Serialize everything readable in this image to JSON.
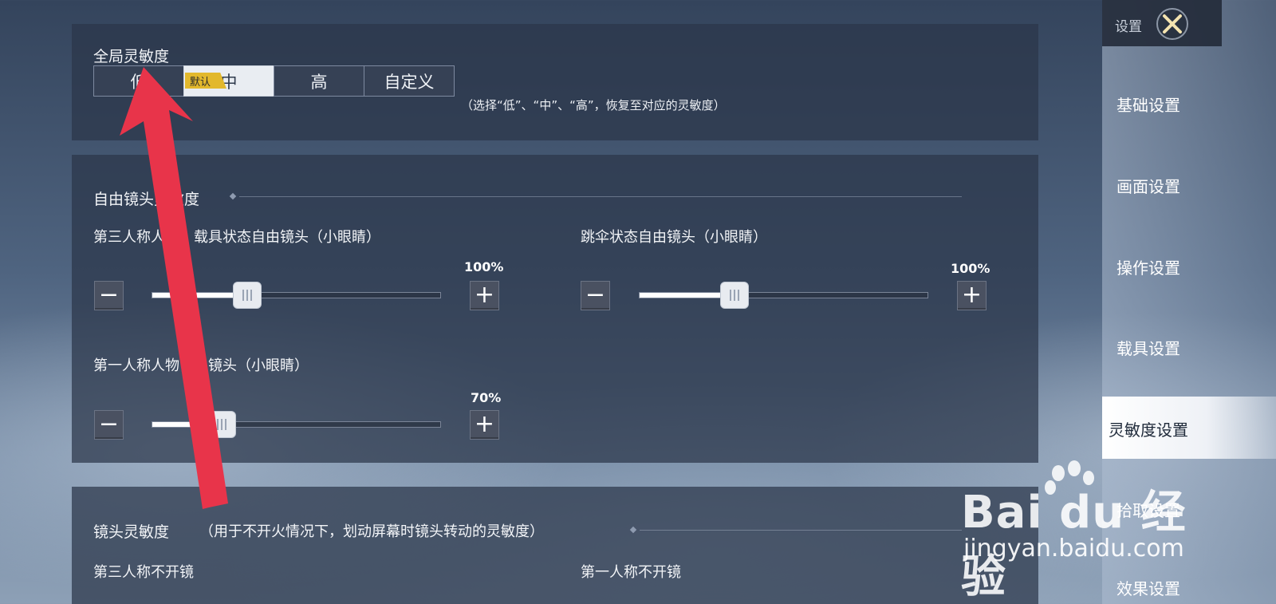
{
  "global": {
    "title": "全局灵敏度",
    "options": [
      "低",
      "中",
      "高",
      "自定义"
    ],
    "selected_index": 1,
    "default_tag": "默认",
    "hint": "（选择“低”、“中”、“高”，恢复至对应的灵敏度）"
  },
  "free_camera": {
    "title": "自由镜头灵敏度",
    "sliders": [
      {
        "label": "第三人称人物、载具状态自由镜头（小眼睛）",
        "value_text": "100%",
        "fill_fraction": 0.33
      },
      {
        "label": "跳伞状态自由镜头（小眼睛）",
        "value_text": "100%",
        "fill_fraction": 0.33
      },
      {
        "label": "第一人称人物自由镜头（小眼睛）",
        "value_text": "70%",
        "fill_fraction": 0.24
      }
    ]
  },
  "camera": {
    "title": "镜头灵敏度",
    "note": "（用于不开火情况下，划动屏幕时镜头转动的灵敏度）",
    "sub_left": "第三人称不开镜",
    "sub_right": "第一人称不开镜"
  },
  "sidebar": {
    "title": "设置",
    "items": [
      "基础设置",
      "画面设置",
      "操作设置",
      "载具设置",
      "灵敏度设置",
      "拾取设置",
      "效果设置"
    ],
    "active_index": 4
  },
  "watermark": {
    "logo": "Bai du 经验",
    "url": "jingyan.baidu.com"
  },
  "colors": {
    "annotation_arrow": "#e8344a",
    "default_tag": "#e2b82c"
  }
}
